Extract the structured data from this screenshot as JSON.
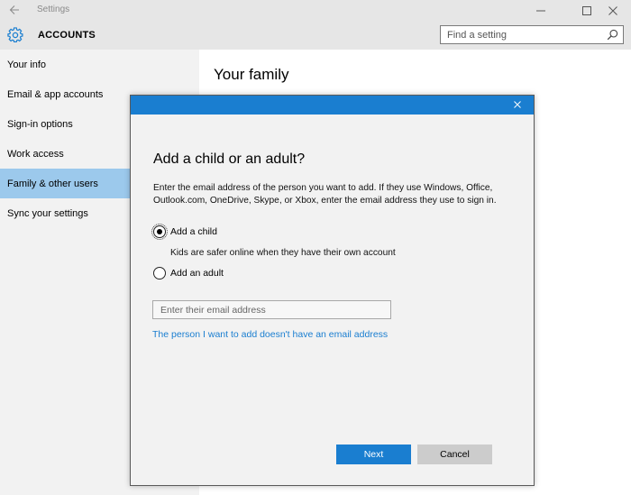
{
  "window": {
    "title": "Settings"
  },
  "header": {
    "section_title": "ACCOUNTS",
    "search_placeholder": "Find a setting"
  },
  "sidebar": {
    "items": [
      {
        "label": "Your info",
        "selected": false
      },
      {
        "label": "Email & app accounts",
        "selected": false
      },
      {
        "label": "Sign-in options",
        "selected": false
      },
      {
        "label": "Work access",
        "selected": false
      },
      {
        "label": "Family & other users",
        "selected": true
      },
      {
        "label": "Sync your settings",
        "selected": false
      }
    ]
  },
  "main": {
    "title": "Your family"
  },
  "dialog": {
    "heading": "Add a child or an adult?",
    "description": "Enter the email address of the person you want to add. If they use Windows, Office, Outlook.com, OneDrive, Skype, or Xbox, enter the email address they use to sign in.",
    "options": [
      {
        "label": "Add a child",
        "checked": true,
        "sublabel": "Kids are safer online when they have their own account"
      },
      {
        "label": "Add an adult",
        "checked": false
      }
    ],
    "email_placeholder": "Enter their email address",
    "no_email_link": "The person I want to add doesn't have an email address",
    "next_label": "Next",
    "cancel_label": "Cancel"
  },
  "colors": {
    "accent": "#1a7ed0",
    "selected_nav": "#9cc9ec",
    "titlebar": "#e6e6e6",
    "sidebar": "#f2f2f2"
  },
  "icons": {
    "back": "back-arrow-icon",
    "settings": "gear-icon",
    "search": "search-icon",
    "minimize": "minimize-icon",
    "maximize": "maximize-icon",
    "close": "close-icon"
  }
}
